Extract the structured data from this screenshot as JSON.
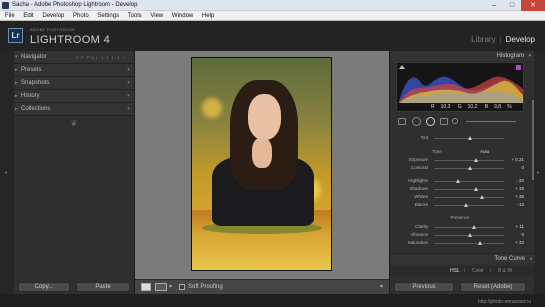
{
  "window": {
    "title": "Sacha - Adobe Photoshop Lightroom - Develop",
    "controls": [
      "–",
      "□",
      "✕"
    ]
  },
  "menu": [
    "File",
    "Edit",
    "Develop",
    "Photo",
    "Settings",
    "Tools",
    "View",
    "Window",
    "Help"
  ],
  "identity": {
    "logo": "Lr",
    "small": "ADOBE PHOTOSHOP",
    "big": "LIGHTROOM 4"
  },
  "modules": {
    "library": "Library",
    "separator": "|",
    "develop": "Develop"
  },
  "left_panel": {
    "navigator": {
      "label": "Navigator",
      "zoom_options": "FIT  FILL  1:1  1:4 ÷"
    },
    "sections": [
      "Presets",
      "Snapshots",
      "History",
      "Collections"
    ],
    "copy": "Copy...",
    "paste": "Paste"
  },
  "toolbar": {
    "soft_proofing": "Soft Proofing"
  },
  "right_panel": {
    "histogram": {
      "label": "Histogram",
      "r": "R",
      "r_val": "10,3",
      "g": "G",
      "g_val": "10,2",
      "b": "B",
      "b_val": "9,8",
      "pct": "%"
    },
    "tone": {
      "label": "Tone",
      "auto": "Auto"
    },
    "sliders_basic": [
      {
        "label": "Tint",
        "value": ""
      },
      {
        "label": "Exposure",
        "value": "+ 0,31"
      },
      {
        "label": "Contrast",
        "value": "0"
      },
      {
        "label": "Highlights",
        "value": "- 32"
      },
      {
        "label": "Shadows",
        "value": "+ 15"
      },
      {
        "label": "Whites",
        "value": "+ 35"
      },
      {
        "label": "Blacks",
        "value": "- 12"
      }
    ],
    "presence": {
      "label": "Presence"
    },
    "sliders_presence": [
      {
        "label": "Clarity",
        "value": "+ 11"
      },
      {
        "label": "Vibrance",
        "value": "0"
      },
      {
        "label": "Saturation",
        "value": "+ 32"
      }
    ],
    "tone_curve": "Tone Curve",
    "hsl_tabs": [
      "HSL",
      "/",
      "Color",
      "/",
      "B & W"
    ],
    "previous": "Previous",
    "reset": "Reset (Adobe)"
  },
  "watermark": "http://photo-ennanser.ru"
}
